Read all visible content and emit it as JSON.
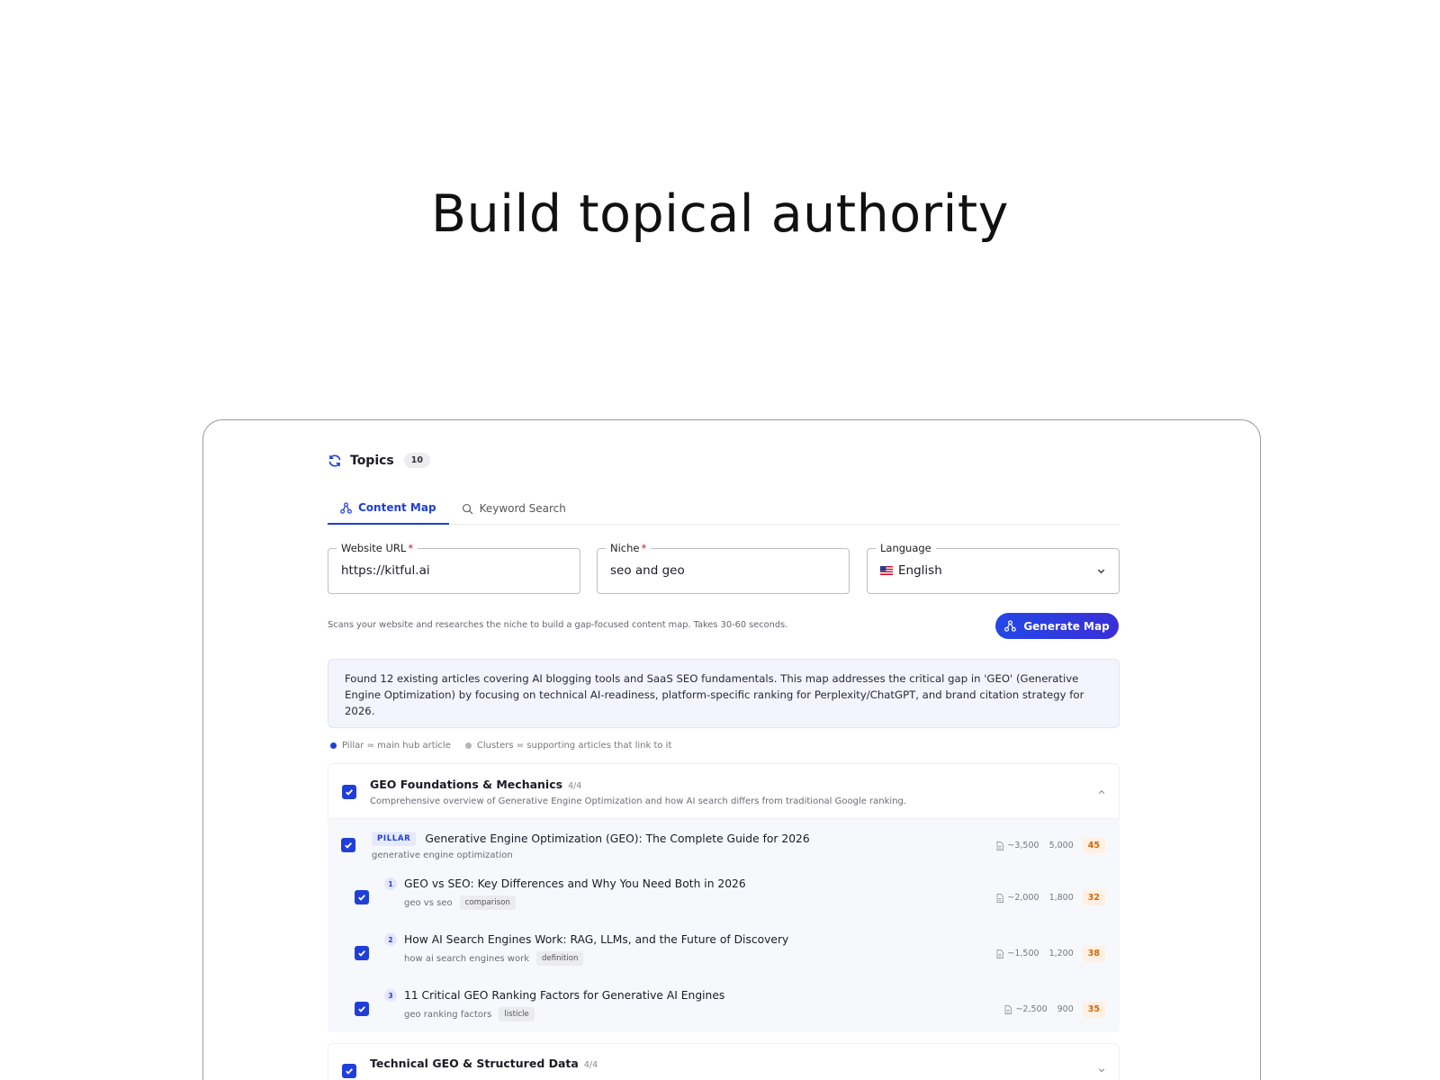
{
  "headline": "Build topical authority",
  "topics": {
    "title": "Topics",
    "count": "10"
  },
  "tabs": [
    {
      "label": "Content Map",
      "icon": "sitemap-icon",
      "active": true
    },
    {
      "label": "Keyword Search",
      "icon": "search-icon",
      "active": false
    }
  ],
  "form": {
    "url": {
      "label": "Website URL",
      "required": "*",
      "value": "https://kitful.ai"
    },
    "niche": {
      "label": "Niche",
      "required": "*",
      "value": "seo and geo"
    },
    "language": {
      "label": "Language",
      "value": "English",
      "flag": "us-flag-icon"
    }
  },
  "hint": "Scans your website and researches the niche to build a gap-focused content map. Takes 30-60 seconds.",
  "generate_button": "Generate Map",
  "summary": "Found 12 existing articles covering AI blogging tools and SaaS SEO fundamentals. This map addresses the critical gap in 'GEO' (Generative Engine Optimization) by focusing on technical AI-readiness, platform-specific ranking for Perplexity/ChatGPT, and brand citation strategy for 2026.",
  "legend": {
    "pillar": "Pillar = main hub article",
    "clusters": "Clusters = supporting articles that link to it"
  },
  "colors": {
    "accent": "#1f3fd8",
    "score": "#d1690f"
  },
  "groups": [
    {
      "title": "GEO Foundations & Mechanics",
      "fraction": "4/4",
      "description": "Comprehensive overview of Generative Engine Optimization and how AI search differs from traditional Google ranking.",
      "pillar": {
        "tag": "PILLAR",
        "title": "Generative Engine Optimization (GEO): The Complete Guide for 2026",
        "keyword": "generative engine optimization",
        "words": "~3,500",
        "volume": "5,000",
        "score": "45"
      },
      "clusters": [
        {
          "num": "1",
          "title": "GEO vs SEO: Key Differences and Why You Need Both in 2026",
          "keyword": "geo vs seo",
          "tag": "comparison",
          "words": "~2,000",
          "volume": "1,800",
          "score": "32"
        },
        {
          "num": "2",
          "title": "How AI Search Engines Work: RAG, LLMs, and the Future of Discovery",
          "keyword": "how ai search engines work",
          "tag": "definition",
          "words": "~1,500",
          "volume": "1,200",
          "score": "38"
        },
        {
          "num": "3",
          "title": "11 Critical GEO Ranking Factors for Generative AI Engines",
          "keyword": "geo ranking factors",
          "tag": "listicle",
          "words": "~2,500",
          "volume": "900",
          "score": "35"
        }
      ]
    },
    {
      "title": "Technical GEO & Structured Data",
      "fraction": "4/4"
    }
  ]
}
